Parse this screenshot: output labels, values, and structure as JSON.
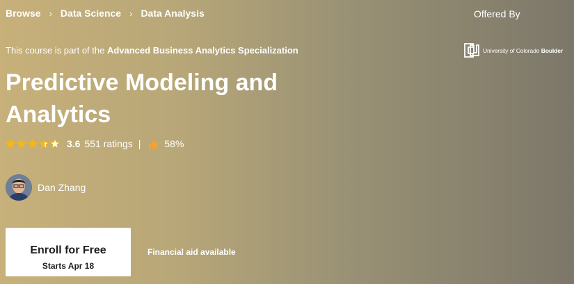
{
  "breadcrumb": [
    {
      "label": "Browse"
    },
    {
      "label": "Data Science"
    },
    {
      "label": "Data Analysis"
    }
  ],
  "offered_by_label": "Offered By",
  "specialization": {
    "prefix": "This course is part of the ",
    "name": "Advanced Business Analytics Specialization"
  },
  "partner": {
    "name_prefix": "University of Colorado ",
    "name_bold": "Boulder"
  },
  "course": {
    "title": "Predictive Modeling and Analytics"
  },
  "rating": {
    "stars": 3.6,
    "value": "3.6",
    "count": "551 ratings",
    "separator": "|",
    "like_percent": "58%"
  },
  "instructor": {
    "name": "Dan Zhang"
  },
  "enroll": {
    "label": "Enroll for Free",
    "start": "Starts Apr 18"
  },
  "financial_aid": "Financial aid available",
  "colors": {
    "star": "#f5b619",
    "thumb": "#f0a33a",
    "button_text": "#1f1f1f"
  }
}
